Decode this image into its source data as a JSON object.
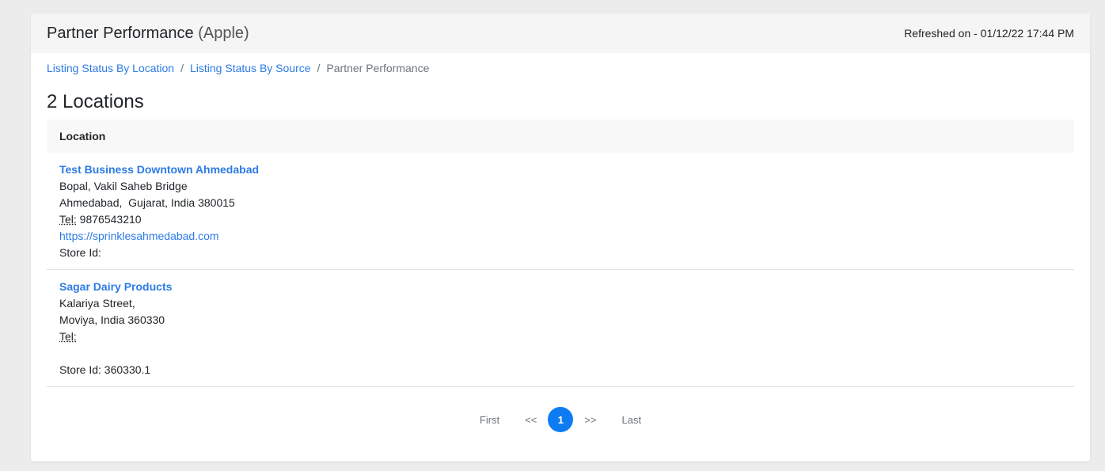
{
  "header": {
    "title": "Partner Performance",
    "subtitle": "(Apple)",
    "refreshed": "Refreshed on - 01/12/22 17:44 PM"
  },
  "breadcrumb": {
    "items": [
      "Listing Status By Location",
      "Listing Status By Source"
    ],
    "separator": "/",
    "active": "Partner Performance"
  },
  "count_heading": "2 Locations",
  "table": {
    "header": "Location",
    "rows": [
      {
        "name": "Test Business Downtown Ahmedabad",
        "address1": "Bopal, Vakil Saheb Bridge",
        "address2": "Ahmedabad,  Gujarat, India 380015",
        "tel_label": "Tel:",
        "tel": " 9876543210",
        "url": "https://sprinklesahmedabad.com",
        "store_id": "Store Id:"
      },
      {
        "name": "Sagar Dairy Products",
        "address1": "Kalariya Street,",
        "address2": "Moviya, India 360330",
        "tel_label": "Tel:",
        "tel": "",
        "url": "",
        "store_id": "Store Id: 360330.1"
      }
    ]
  },
  "pagination": {
    "first": "First",
    "prev": "<<",
    "current": "1",
    "next": ">>",
    "last": "Last"
  },
  "colors": {
    "link": "#2c7be5",
    "active_page": "#0d7cf2",
    "header_bg": "#f5f5f5"
  }
}
